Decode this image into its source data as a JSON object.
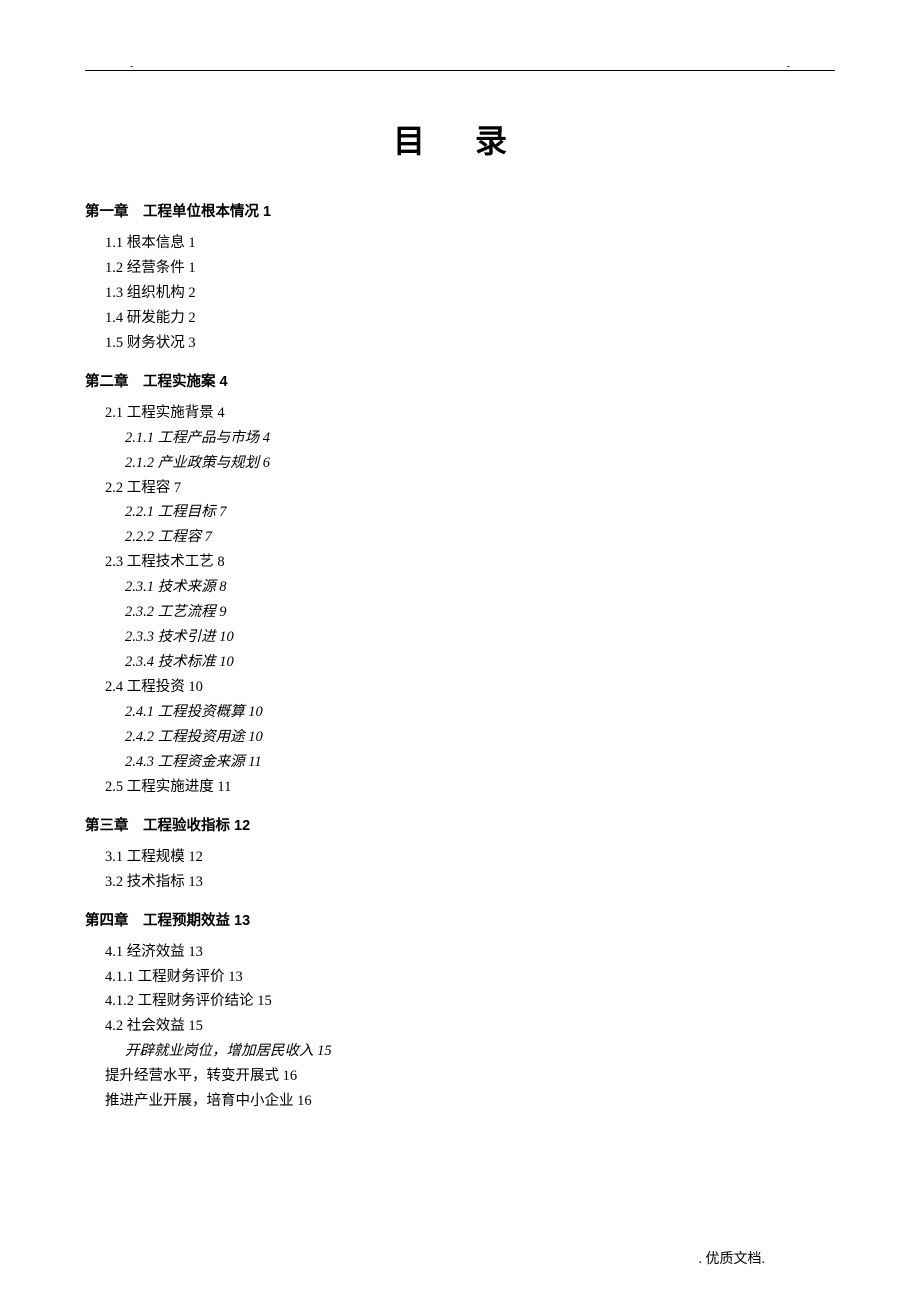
{
  "title": "目录",
  "header_mark_left": "-",
  "header_mark_right": "-",
  "chapters": [
    {
      "heading": "第一章　工程单位根本情况 1",
      "items": [
        {
          "text": "1.1 根本信息 1",
          "type": "item"
        },
        {
          "text": "1.2 经营条件 1",
          "type": "item"
        },
        {
          "text": "1.3 组织机构 2",
          "type": "item"
        },
        {
          "text": "1.4 研发能力 2",
          "type": "item"
        },
        {
          "text": "1.5 财务状况 3",
          "type": "item"
        }
      ]
    },
    {
      "heading": "第二章　工程实施案 4",
      "items": [
        {
          "text": "2.1 工程实施背景 4",
          "type": "item"
        },
        {
          "text": "2.1.1 工程产品与市场 4",
          "type": "sub"
        },
        {
          "text": "2.1.2 产业政策与规划 6",
          "type": "sub"
        },
        {
          "text": "2.2 工程容 7",
          "type": "item"
        },
        {
          "text": "2.2.1 工程目标 7",
          "type": "sub"
        },
        {
          "text": "2.2.2 工程容 7",
          "type": "sub"
        },
        {
          "text": "2.3 工程技术工艺 8",
          "type": "item"
        },
        {
          "text": "2.3.1 技术来源 8",
          "type": "sub"
        },
        {
          "text": "2.3.2 工艺流程 9",
          "type": "sub"
        },
        {
          "text": "2.3.3 技术引进 10",
          "type": "sub"
        },
        {
          "text": "2.3.4 技术标准 10",
          "type": "sub"
        },
        {
          "text": "2.4 工程投资 10",
          "type": "item"
        },
        {
          "text": "2.4.1 工程投资概算 10",
          "type": "sub"
        },
        {
          "text": "2.4.2 工程投资用途 10",
          "type": "sub"
        },
        {
          "text": "2.4.3 工程资金来源 11",
          "type": "sub"
        },
        {
          "text": "2.5 工程实施进度 11",
          "type": "item"
        }
      ]
    },
    {
      "heading": "第三章　工程验收指标 12",
      "items": [
        {
          "text": "3.1 工程规模 12",
          "type": "item"
        },
        {
          "text": "3.2 技术指标 13",
          "type": "item"
        }
      ]
    },
    {
      "heading": "第四章　工程预期效益 13",
      "items": [
        {
          "text": "4.1 经济效益 13",
          "type": "item"
        },
        {
          "text": "4.1.1 工程财务评价 13",
          "type": "sub-plain"
        },
        {
          "text": "4.1.2 工程财务评价结论 15",
          "type": "sub-plain"
        },
        {
          "text": "4.2 社会效益 15",
          "type": "item"
        },
        {
          "text": "开辟就业岗位，增加居民收入 15",
          "type": "sub2"
        },
        {
          "text": "提升经营水平，转变开展式 16",
          "type": "item"
        },
        {
          "text": "推进产业开展，培育中小企业 16",
          "type": "item"
        }
      ]
    }
  ],
  "footer": ". 优质文档."
}
